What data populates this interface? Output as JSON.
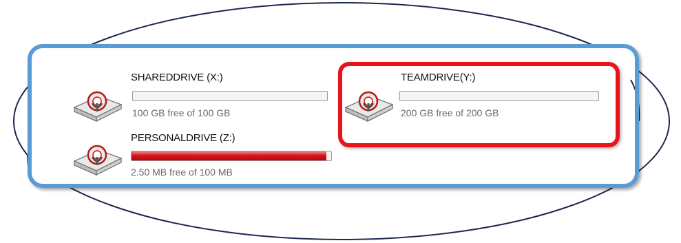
{
  "drives": [
    {
      "name": "SHAREDDRIVE (X:)",
      "free": "100 GB free of 100 GB",
      "used_fraction": 0.0,
      "icon": "network-drive-icon"
    },
    {
      "name": "TEAMDRIVE(Y:)",
      "free": "200 GB free of 200 GB",
      "used_fraction": 0.0,
      "icon": "network-drive-icon"
    },
    {
      "name": "PERSONALDRIVE (Z:)",
      "free": "2.50 MB free of 100 MB",
      "used_fraction": 0.975,
      "icon": "network-drive-icon"
    }
  ],
  "colors": {
    "blue_highlight": "#5b9bd5",
    "red_highlight": "#e8141c",
    "full_bar": "#d8141b"
  }
}
